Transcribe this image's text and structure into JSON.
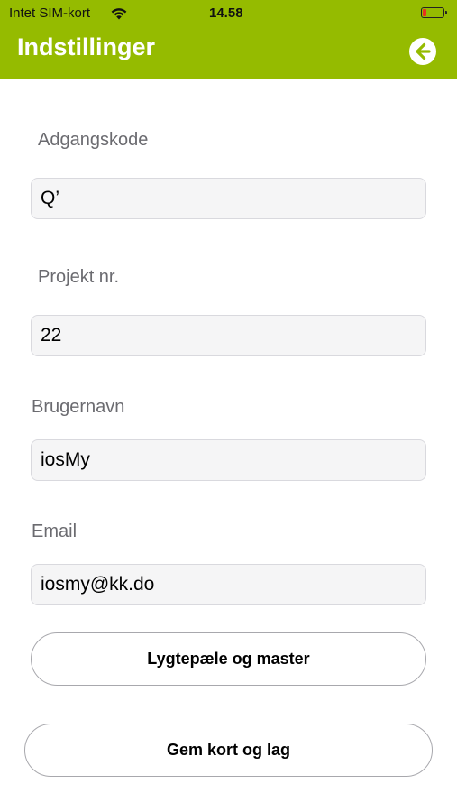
{
  "status_bar": {
    "carrier": "Intet SIM-kort",
    "time": "14.58",
    "wifi_icon": "wifi-icon",
    "battery_icon": "battery-icon",
    "battery_color": "#e8311f"
  },
  "nav": {
    "title": "Indstillinger",
    "back_icon": "arrow-left-circle-icon",
    "bar_color": "#95bb00"
  },
  "fields": {
    "password": {
      "label": "Adgangskode",
      "value": "Q’"
    },
    "project": {
      "label": "Projekt nr.",
      "value": "22"
    },
    "username": {
      "label": "Brugernavn",
      "value": "iosMy"
    },
    "email": {
      "label": "Email",
      "value": "iosmy@kk.do"
    }
  },
  "buttons": {
    "poles": "Lygtepæle og master",
    "save_map": "Gem kort og lag"
  }
}
